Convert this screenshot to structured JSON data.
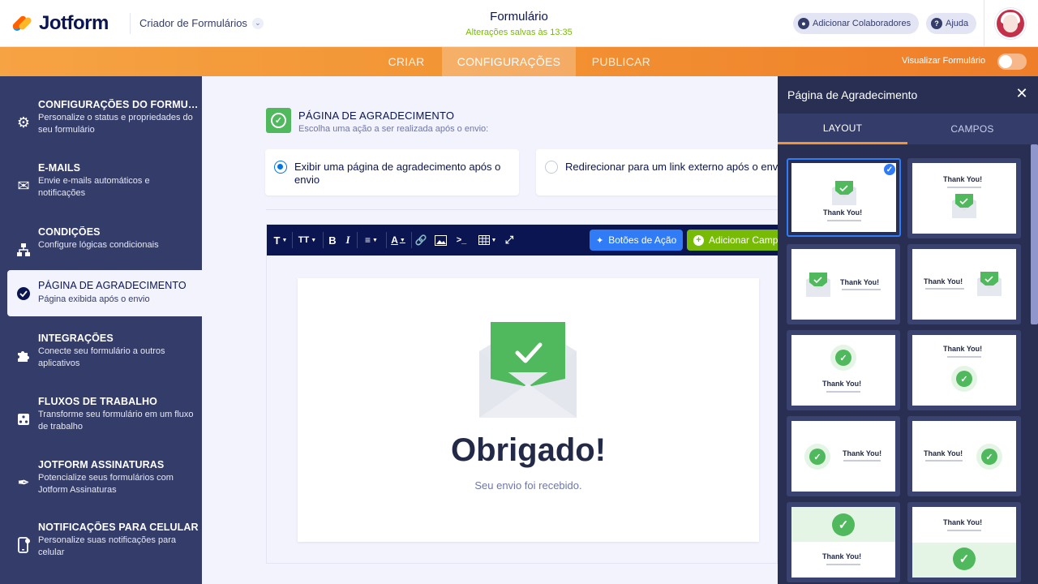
{
  "header": {
    "logo_text": "Jotform",
    "builder_title": "Criador de Formulários",
    "form_title": "Formulário",
    "saved_status": "Alterações salvas às 13:35",
    "add_collaborators": "Adicionar Colaboradores",
    "help": "Ajuda"
  },
  "nav": {
    "tabs": [
      "CRIAR",
      "CONFIGURAÇÕES",
      "PUBLICAR"
    ],
    "active_tab": "CONFIGURAÇÕES",
    "preview_label": "Visualizar Formulário",
    "preview_toggle_on": false
  },
  "sidebar": {
    "items": [
      {
        "title": "CONFIGURAÇÕES DO FORMULÁRIO",
        "desc": "Personalize o status e propriedades do seu formulário",
        "icon": "gear-icon"
      },
      {
        "title": "E-MAILS",
        "desc": "Envie e-mails automáticos e notificações",
        "icon": "envelope-icon"
      },
      {
        "title": "CONDIÇÕES",
        "desc": "Configure lógicas condicionais",
        "icon": "hierarchy-icon"
      },
      {
        "title": "PÁGINA DE AGRADECIMENTO",
        "desc": "Página exibida após o envio",
        "icon": "check-circle-icon"
      },
      {
        "title": "INTEGRAÇÕES",
        "desc": "Conecte seu formulário a outros aplicativos",
        "icon": "puzzle-icon"
      },
      {
        "title": "FLUXOS DE TRABALHO",
        "desc": "Transforme seu formulário em um fluxo de trabalho",
        "icon": "workflow-icon"
      },
      {
        "title": "JOTFORM ASSINATURAS",
        "desc": "Potencialize seus formulários com Jotform Assinaturas",
        "icon": "signature-pen-icon"
      },
      {
        "title": "NOTIFICAÇÕES PARA CELULAR",
        "desc": "Personalize suas notificações para celular",
        "icon": "mobile-notification-icon"
      }
    ],
    "active_index": 3
  },
  "main": {
    "section_title": "PÁGINA DE AGRADECIMENTO",
    "section_subtitle": "Escolha uma ação a ser realizada após o envio:",
    "option_show_page": "Exibir uma página de agradecimento após o envio",
    "option_redirect": "Redirecionar para um link externo após o envio",
    "selected_option": "show_page",
    "toolbar": {
      "action_buttons": "Botões de Ação",
      "add_field": "Adicionar Campo"
    },
    "preview": {
      "heading": "Obrigado!",
      "subtext": "Seu envio foi recebido."
    }
  },
  "right_panel": {
    "title": "Página de Agradecimento",
    "tabs": [
      "LAYOUT",
      "CAMPOS"
    ],
    "active_tab": "LAYOUT",
    "layout_label": "Thank You!",
    "layouts": [
      "envelope-top",
      "envelope-bottom",
      "envelope-left",
      "envelope-right",
      "circle-top",
      "circle-bottom",
      "circle-left",
      "circle-right",
      "band-top",
      "band-bottom"
    ],
    "selected_layout": 0
  },
  "colors": {
    "brand_orange": "#f29434",
    "sidebar": "#343c6a",
    "panel": "#282f53",
    "success_green": "#50b85d",
    "primary_blue": "#2f7cf6",
    "add_field_green": "#78bb07"
  }
}
